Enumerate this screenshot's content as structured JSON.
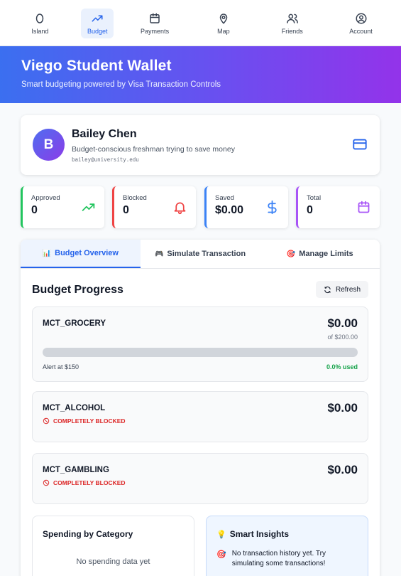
{
  "nav": {
    "items": [
      {
        "label": "Island",
        "icon": "island-icon"
      },
      {
        "label": "Budget",
        "icon": "trend-up-icon"
      },
      {
        "label": "Payments",
        "icon": "calendar-icon"
      },
      {
        "label": "Map",
        "icon": "map-pin-icon"
      },
      {
        "label": "Friends",
        "icon": "users-icon"
      },
      {
        "label": "Account",
        "icon": "account-icon"
      }
    ],
    "active": "Budget"
  },
  "header": {
    "title": "Viego Student Wallet",
    "subtitle": "Smart budgeting powered by Visa Transaction Controls"
  },
  "profile": {
    "initial": "B",
    "name": "Bailey Chen",
    "description": "Budget-conscious freshman trying to save money",
    "email": "bailey@university.edu"
  },
  "stats": [
    {
      "label": "Approved",
      "value": "0",
      "icon": "trend-up-icon",
      "color": "#22c55e"
    },
    {
      "label": "Blocked",
      "value": "0",
      "icon": "bell-icon",
      "color": "#ef4444"
    },
    {
      "label": "Saved",
      "value": "$0.00",
      "icon": "dollar-icon",
      "color": "#3b82f6"
    },
    {
      "label": "Total",
      "value": "0",
      "icon": "calendar-icon",
      "color": "#a855f7"
    }
  ],
  "tabs": [
    {
      "emoji": "📊",
      "label": "Budget Overview",
      "active": true
    },
    {
      "emoji": "🎮",
      "label": "Simulate Transaction",
      "active": false
    },
    {
      "emoji": "🎯",
      "label": "Manage Limits",
      "active": false
    }
  ],
  "budget_progress": {
    "title": "Budget Progress",
    "refresh_label": "Refresh",
    "categories": [
      {
        "name": "MCT_GROCERY",
        "amount": "$0.00",
        "limit": "of $200.00",
        "alert": "Alert at $150",
        "used": "0.0% used",
        "used_fraction": 0.0
      },
      {
        "name": "MCT_ALCOHOL",
        "amount": "$0.00",
        "status": "COMPLETELY BLOCKED"
      },
      {
        "name": "MCT_GAMBLING",
        "amount": "$0.00",
        "status": "COMPLETELY BLOCKED"
      }
    ]
  },
  "spending": {
    "title": "Spending by Category",
    "empty": "No spending data yet"
  },
  "insights": {
    "emoji": "💡",
    "title": "Smart Insights",
    "item_emoji": "🎯",
    "item": "No transaction history yet. Try simulating some transactions!"
  },
  "colors": {
    "accent": "#2563eb",
    "danger": "#dc2626",
    "success": "#16a34a"
  }
}
